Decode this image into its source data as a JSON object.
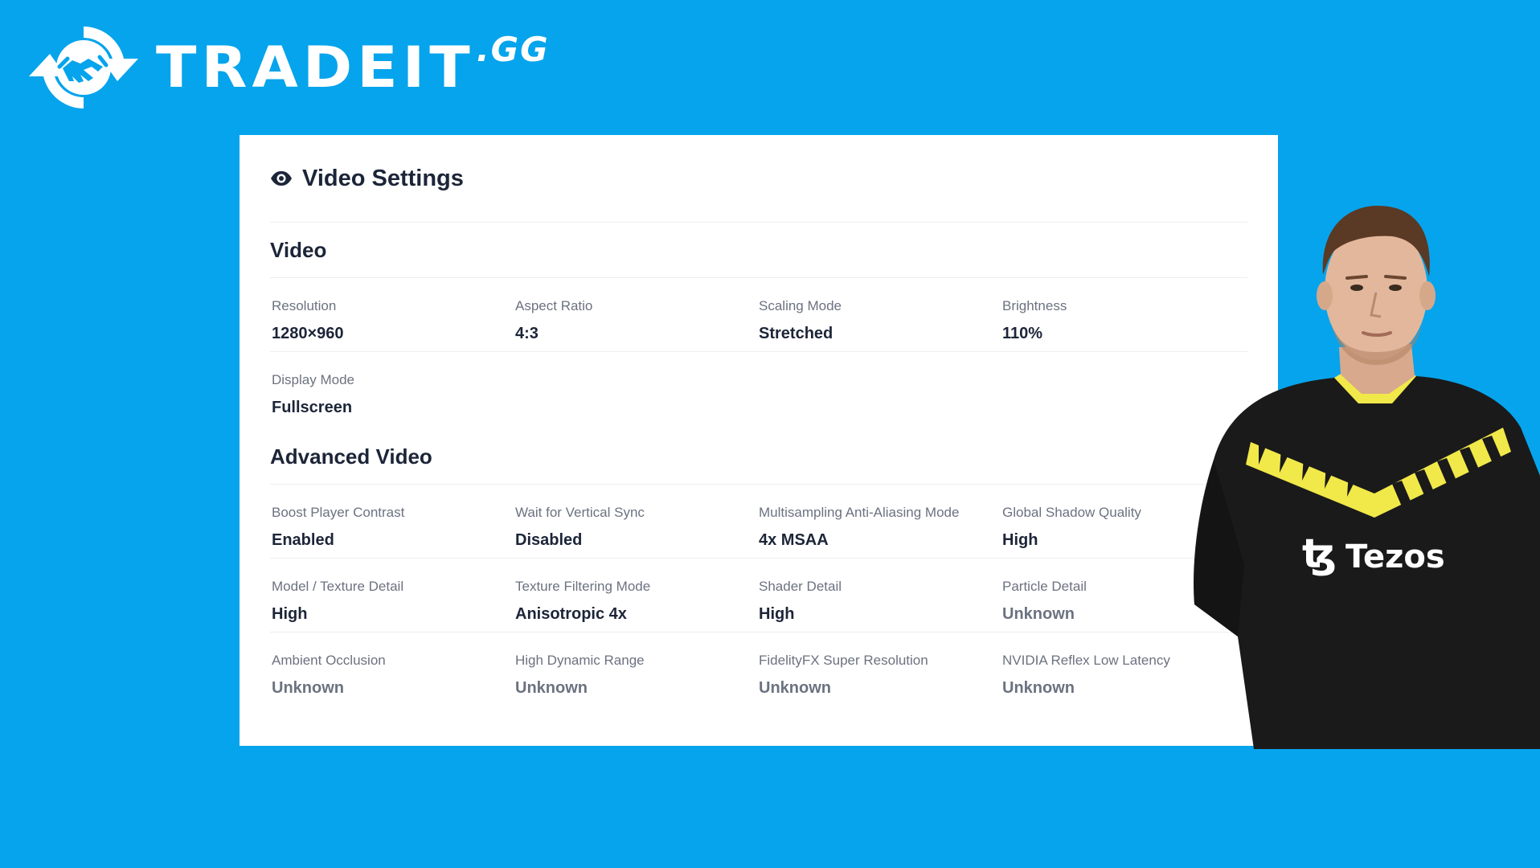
{
  "brand": {
    "name": "TRADEIT",
    "tld": ".GG",
    "logo_icon": "handshake-icon"
  },
  "card": {
    "icon": "eye-icon",
    "title": "Video Settings"
  },
  "sections": [
    {
      "title": "Video",
      "rows": [
        [
          {
            "label": "Resolution",
            "value": "1280×960"
          },
          {
            "label": "Aspect Ratio",
            "value": "4:3"
          },
          {
            "label": "Scaling Mode",
            "value": "Stretched"
          },
          {
            "label": "Brightness",
            "value": "110%"
          }
        ],
        [
          {
            "label": "Display Mode",
            "value": "Fullscreen"
          }
        ]
      ]
    },
    {
      "title": "Advanced Video",
      "rows": [
        [
          {
            "label": "Boost Player Contrast",
            "value": "Enabled"
          },
          {
            "label": "Wait for Vertical Sync",
            "value": "Disabled"
          },
          {
            "label": "Multisampling Anti-Aliasing Mode",
            "value": "4x MSAA"
          },
          {
            "label": "Global Shadow Quality",
            "value": "High"
          }
        ],
        [
          {
            "label": "Model / Texture Detail",
            "value": "High"
          },
          {
            "label": "Texture Filtering Mode",
            "value": "Anisotropic 4x"
          },
          {
            "label": "Shader Detail",
            "value": "High"
          },
          {
            "label": "Particle Detail",
            "value": "Unknown"
          }
        ],
        [
          {
            "label": "Ambient Occlusion",
            "value": "Unknown"
          },
          {
            "label": "High Dynamic Range",
            "value": "Unknown"
          },
          {
            "label": "FidelityFX Super Resolution",
            "value": "Unknown"
          },
          {
            "label": "NVIDIA Reflex Low Latency",
            "value": "Unknown"
          }
        ]
      ]
    }
  ],
  "player": {
    "sponsor": "Tezos",
    "sponsor_mark": "ꜩ"
  },
  "colors": {
    "background": "#06a4ec",
    "card": "#ffffff",
    "title": "#1c2538",
    "label": "#6b7280",
    "jersey": "#1a1a1a",
    "jersey_accent": "#f1e84a"
  }
}
